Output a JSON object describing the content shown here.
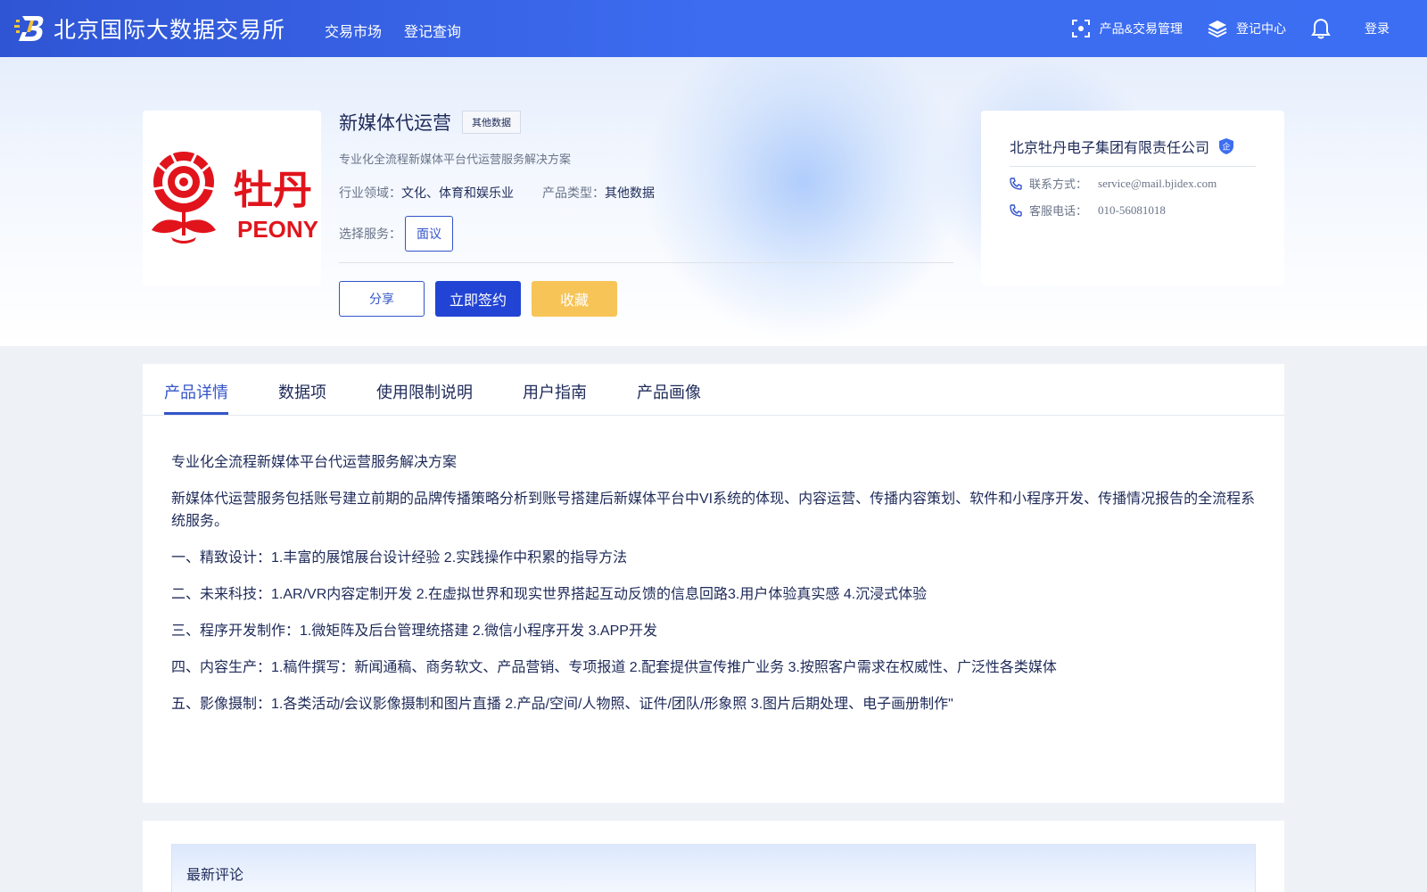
{
  "header": {
    "site_name": "北京国际大数据交易所",
    "nav": [
      "交易市场",
      "登记查询"
    ],
    "product_mgmt": "产品&交易管理",
    "register_center": "登记中心",
    "login": "登录"
  },
  "product": {
    "title": "新媒体代运营",
    "tag": "其他数据",
    "subtitle": "专业化全流程新媒体平台代运营服务解决方案",
    "industry_label": "行业领域：",
    "industry_value": "文化、体育和娱乐业",
    "type_label": "产品类型：",
    "type_value": "其他数据",
    "service_label": "选择服务：",
    "service_option": "面议",
    "logo_text": "PEONY",
    "logo_cn": "牡丹",
    "share_label": "分享",
    "sign_label": "立即签约",
    "fav_label": "收藏"
  },
  "company": {
    "name": "北京牡丹电子集团有限责任公司",
    "badge": "企",
    "contact_label": "联系方式：",
    "contact_value": "service@mail.bjidex.com",
    "phone_label": "客服电话：",
    "phone_value": "010-56081018"
  },
  "tabs": [
    "产品详情",
    "数据项",
    "使用限制说明",
    "用户指南",
    "产品画像"
  ],
  "details": [
    "专业化全流程新媒体平台代运营服务解决方案",
    "新媒体代运营服务包括账号建立前期的品牌传播策略分析到账号搭建后新媒体平台中VI系统的体现、内容运营、传播内容策划、软件和小程序开发、传播情况报告的全流程系统服务。",
    "一、精致设计：1.丰富的展馆展台设计经验 2.实践操作中积累的指导方法",
    "二、未来科技：1.AR/VR内容定制开发 2.在虚拟世界和现实世界搭起互动反馈的信息回路3.用户体验真实感 4.沉浸式体验",
    "三、程序开发制作：1.微矩阵及后台管理统搭建 2.微信小程序开发 3.APP开发",
    "四、内容生产：1.稿件撰写：新闻通稿、商务软文、产品营销、专项报道 2.配套提供宣传推广业务 3.按照客户需求在权威性、广泛性各类媒体",
    "五、影像摄制：1.各类活动/会议影像摄制和图片直播 2.产品/空间/人物照、证件/团队/形象照 3.图片后期处理、电子画册制作\""
  ],
  "comments": {
    "title": "最新评论"
  },
  "colors": {
    "primary": "#3354c8",
    "header": "#3b6ef2",
    "favorite": "#f7c458",
    "logo_red": "#e1141c"
  }
}
